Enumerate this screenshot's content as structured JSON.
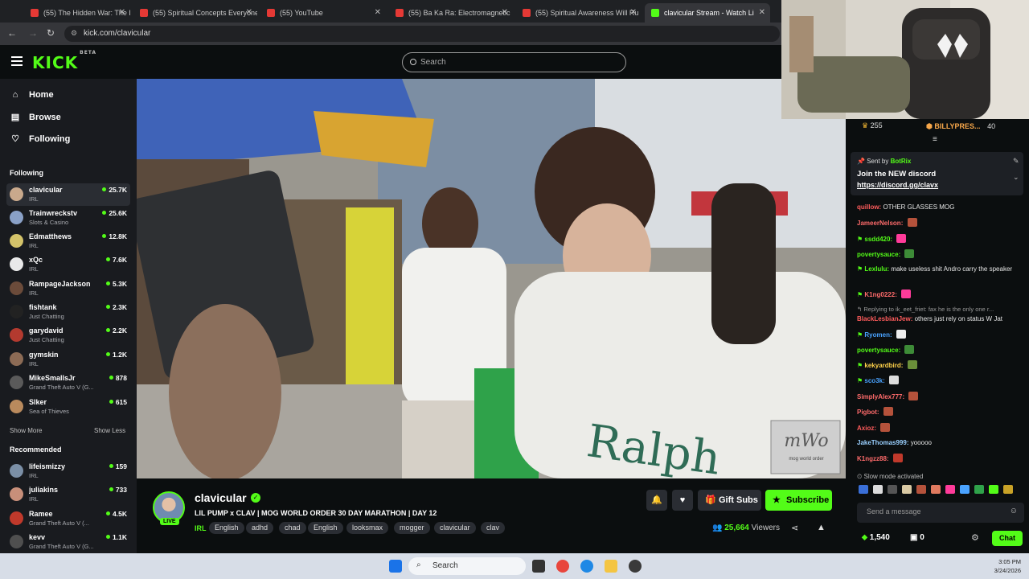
{
  "browser": {
    "tabs": [
      {
        "title": "(55) The Hidden War: The Loosh",
        "kind": "youtube"
      },
      {
        "title": "(55) Spiritual Concepts Everyone",
        "kind": "youtube"
      },
      {
        "title": "(55) YouTube",
        "kind": "youtube"
      },
      {
        "title": "(55) Ba Ka Ra: Electromagnetic",
        "kind": "youtube"
      },
      {
        "title": "(55) Spiritual Awareness Will Ru",
        "kind": "youtube"
      },
      {
        "title": "clavicular Stream - Watch Li",
        "kind": "kick",
        "active": true
      }
    ],
    "url": "kick.com/clavicular"
  },
  "header": {
    "logo": "KICK",
    "logo_badge": "BETA",
    "search_placeholder": "Search"
  },
  "sidebar": {
    "nav": [
      {
        "label": "Home",
        "icon": "home-icon"
      },
      {
        "label": "Browse",
        "icon": "browse-icon"
      },
      {
        "label": "Following",
        "icon": "heart-icon"
      }
    ],
    "following_title": "Following",
    "following": [
      {
        "name": "clavicular",
        "category": "IRL",
        "viewers": "25.7K",
        "color": "#c9a98c"
      },
      {
        "name": "Trainwreckstv",
        "category": "Slots & Casino",
        "viewers": "25.6K",
        "color": "#8aa1c7"
      },
      {
        "name": "Edmatthews",
        "category": "IRL",
        "viewers": "12.8K",
        "color": "#d4c36a"
      },
      {
        "name": "xQc",
        "category": "IRL",
        "viewers": "7.6K",
        "color": "#e9e9e9"
      },
      {
        "name": "RampageJackson",
        "category": "IRL",
        "viewers": "5.3K",
        "color": "#6b4b3a"
      },
      {
        "name": "fishtank",
        "category": "Just Chatting",
        "viewers": "2.3K",
        "color": "#222222"
      },
      {
        "name": "garydavid",
        "category": "Just Chatting",
        "viewers": "2.2K",
        "color": "#b33a2f"
      },
      {
        "name": "gymskin",
        "category": "IRL",
        "viewers": "1.2K",
        "color": "#8c6b55"
      },
      {
        "name": "MikeSmallsJr",
        "category": "Grand Theft Auto V (G...",
        "viewers": "878",
        "color": "#5a5a5a"
      },
      {
        "name": "Slker",
        "category": "Sea of Thieves",
        "viewers": "615",
        "color": "#b98a5d"
      }
    ],
    "show_more": "Show More",
    "show_less": "Show Less",
    "recommended_title": "Recommended",
    "recommended": [
      {
        "name": "lifeismizzy",
        "category": "IRL",
        "viewers": "159",
        "color": "#7b8fa6"
      },
      {
        "name": "juliakins",
        "category": "IRL",
        "viewers": "733",
        "color": "#c88f7a"
      },
      {
        "name": "Ramee",
        "category": "Grand Theft Auto V (...",
        "viewers": "4.5K",
        "color": "#c0392b"
      },
      {
        "name": "kevv",
        "category": "Grand Theft Auto V (G...",
        "viewers": "1.1K",
        "color": "#4f4f4f"
      }
    ]
  },
  "video": {
    "overlay_logo": "mWo",
    "overlay_sub": "mog world order"
  },
  "stream": {
    "streamer": "clavicular",
    "live_label": "LIVE",
    "title": "LIL PUMP x CLAV | MOG WORLD ORDER 30 DAY MARATHON | DAY 12",
    "category": "IRL",
    "tags": [
      "English",
      "adhd",
      "chad",
      "English",
      "looksmax",
      "mogger",
      "clavicular",
      "clav"
    ],
    "gift_label": "Gift Subs",
    "subscribe_label": "Subscribe",
    "viewers": "25,664",
    "viewers_label": "Viewers"
  },
  "chat": {
    "top_left_count": "255",
    "top_right_name": "BILLYPRES...",
    "top_right_count": "40",
    "pinned_sender_label": "Sent by",
    "pinned_sender": "BotRix",
    "pinned_text": "Join the NEW discord",
    "pinned_link": "https://discord.gg/clavx",
    "messages": [
      {
        "user": "quillow:",
        "text": "OTHER GLASSES MOG",
        "color": "#ff5c5c"
      },
      {
        "user": "JameerNelson:",
        "text": "",
        "color": "#ff6b6b",
        "emote": "#b5523b"
      },
      {
        "user": "ssdd420:",
        "text": "",
        "color": "#53fc18",
        "emote": "#ff3b9a"
      },
      {
        "user": "povertysauce:",
        "text": "",
        "color": "#53fc18",
        "emote": "#3d8b37"
      },
      {
        "user": "Lexlulu:",
        "text": "make useless shit Andro carry the speaker",
        "color": "#53fc18"
      },
      {
        "user": "K1ng0222:",
        "text": "",
        "color": "#ff6b6b",
        "emote": "#ff3b9a"
      },
      {
        "user": "",
        "text": "Replying to ik_eet_friet: fax he is the only one r...",
        "color": "#9a9a9a",
        "reply": true
      },
      {
        "user": "BlackLesbianJew:",
        "text": "others just rely on status W Jat",
        "color": "#ff5c5c"
      },
      {
        "user": "Ryomen:",
        "text": "",
        "color": "#4aa3ff",
        "emote": "#eeeeee"
      },
      {
        "user": "povertysauce:",
        "text": "",
        "color": "#53fc18",
        "emote": "#3d8b37"
      },
      {
        "user": "kekyardbird:",
        "text": "",
        "color": "#ffd24a",
        "emote": "#6b8f3a"
      },
      {
        "user": "sco3k:",
        "text": "",
        "color": "#4aa3ff",
        "emote": "#dddddd"
      },
      {
        "user": "SimplyAlex777:",
        "text": "",
        "color": "#ff6b6b",
        "emote": "#b5523b"
      },
      {
        "user": "Pigbot:",
        "text": "",
        "color": "#ff6b6b",
        "emote": "#b5523b"
      },
      {
        "user": "Axioz:",
        "text": "",
        "color": "#ff5c5c",
        "emote": "#b5523b"
      },
      {
        "user": "JakeThomas999:",
        "text": "yooooo",
        "color": "#9ad0ff"
      },
      {
        "user": "K1ngzz88:",
        "text": "",
        "color": "#ff6b6b",
        "emote": "#c0392b"
      }
    ],
    "slow_mode": "Slow mode activated",
    "input_placeholder": "Send a message",
    "points": "1,540",
    "gifts": "0",
    "chat_button": "Chat"
  },
  "taskbar": {
    "search_label": "Search",
    "time": "3:05 PM",
    "date": "3/24/2026"
  },
  "colors": {
    "accent": "#53fc18",
    "sidebar_bg": "#191b1f",
    "page_bg": "#0b0e0f"
  }
}
